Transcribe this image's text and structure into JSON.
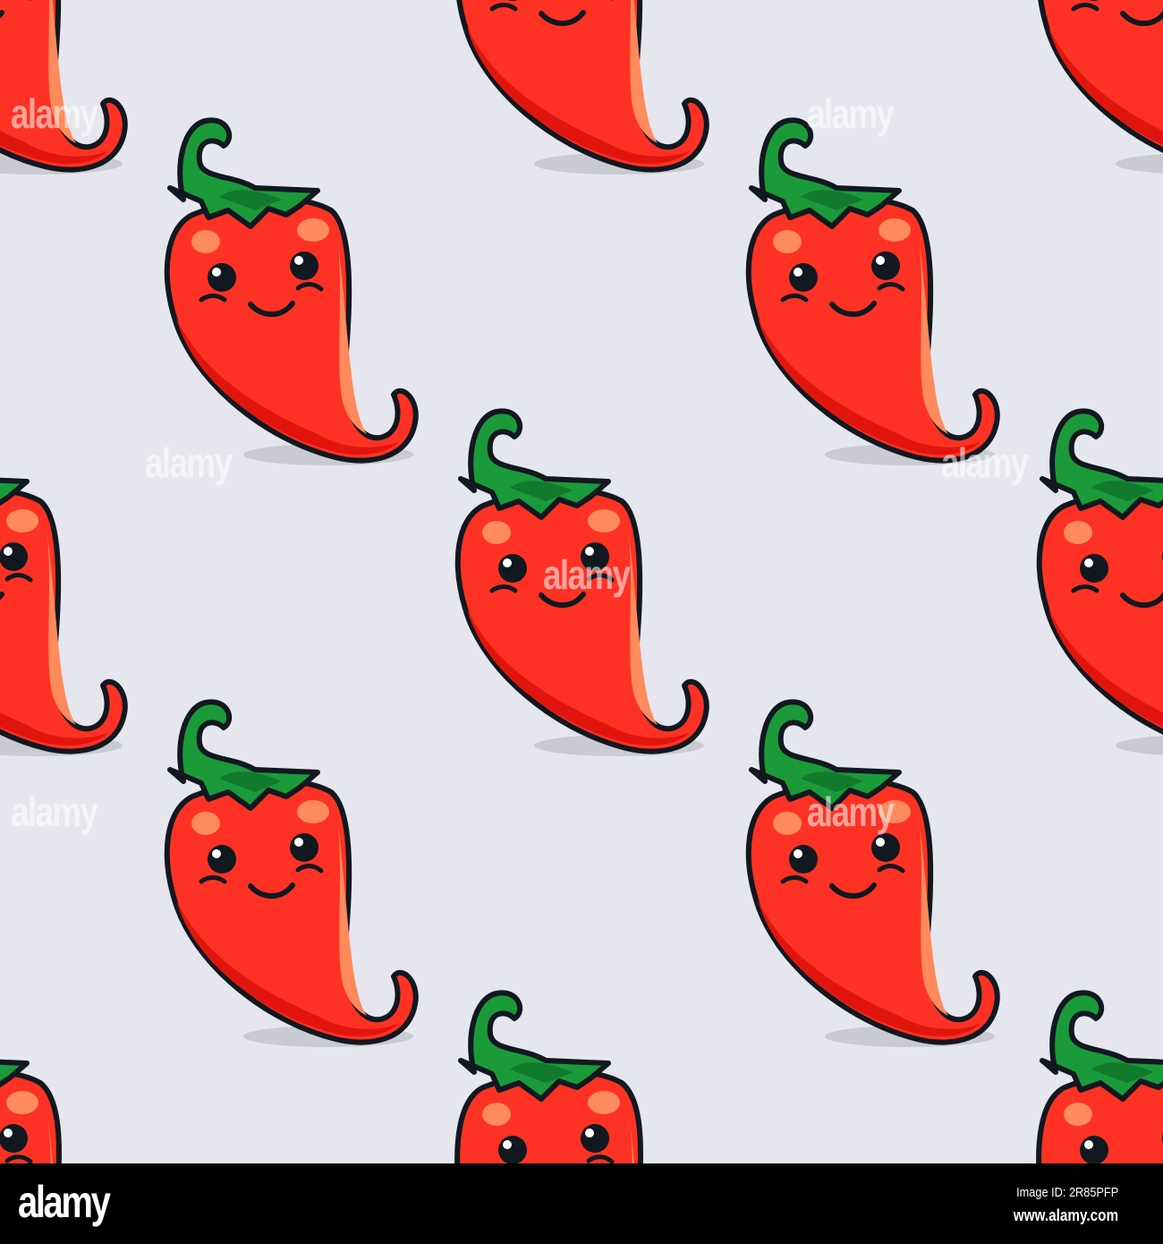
{
  "image": {
    "subject": "chili-pepper-pattern",
    "colors": {
      "background": "#e6e6ee",
      "pepper": "#fe3224",
      "pepper_dark": "#e0160e",
      "highlight": "#ff8a5c",
      "leaf": "#1b9a3a",
      "leaf_dark": "#127a2c",
      "outline": "#111820",
      "shadow": "#cacad2"
    }
  },
  "watermark": "alamy",
  "footer": {
    "logo": "alamy",
    "image_id": "Image ID: 2R85PFP",
    "url": "www.alamy.com"
  }
}
